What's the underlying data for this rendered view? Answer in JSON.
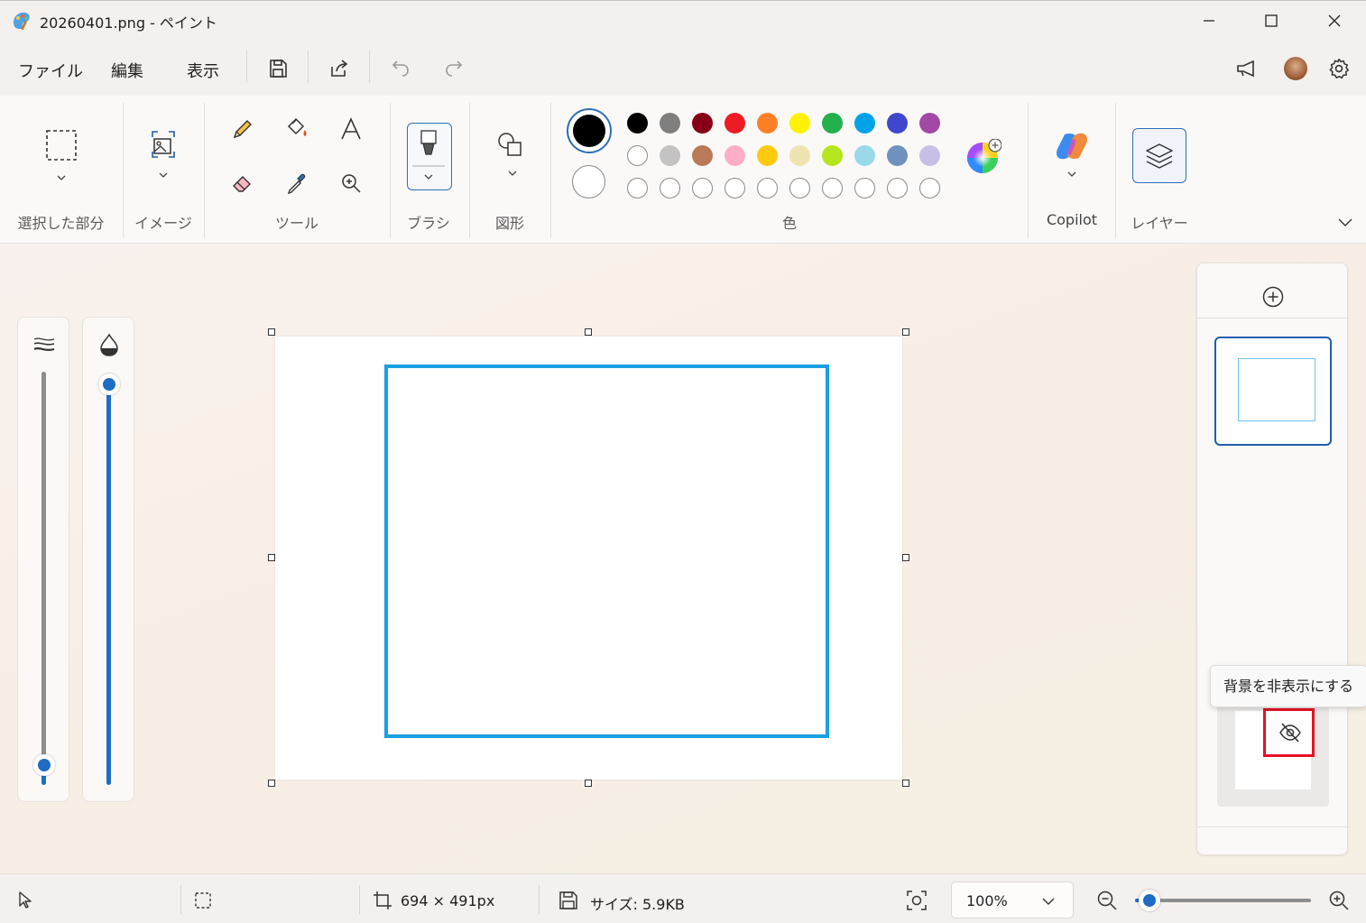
{
  "window": {
    "title": "20260401.png - ペイント",
    "icon": "paint-app-icon",
    "controls": [
      "minimize-icon",
      "maximize-icon",
      "close-icon"
    ]
  },
  "menu": {
    "file": "ファイル",
    "edit": "編集",
    "view": "表示",
    "toolbar_icons": [
      "save-icon",
      "share-icon",
      "undo-icon",
      "redo-icon"
    ],
    "right_icons": [
      "announcement-icon",
      "avatar",
      "settings-icon"
    ]
  },
  "ribbon": {
    "groups": {
      "selection": "選択した部分",
      "image": "イメージ",
      "tools": "ツール",
      "brush": "ブラシ",
      "shapes": "図形",
      "colors": "色",
      "copilot": "Copilot",
      "layers": "レイヤー"
    },
    "tools": [
      "pencil-icon",
      "fill-icon",
      "text-icon",
      "eraser-icon",
      "color-picker-icon",
      "magnifier-icon"
    ],
    "primary_color": "#000000",
    "secondary_color": "#ffffff",
    "palette_row1": [
      "#000000",
      "#7f7f7f",
      "#880015",
      "#ed1c24",
      "#ff7f27",
      "#fff200",
      "#22b14c",
      "#00a2e8",
      "#3f48cc",
      "#a349a4"
    ],
    "palette_row2": [
      "#ffffff",
      "#c3c3c3",
      "#b97a57",
      "#ffaec9",
      "#ffc90e",
      "#efe4b0",
      "#b5e61d",
      "#99d9ea",
      "#7092be",
      "#c8bfe7"
    ],
    "palette_row3_count": 10
  },
  "canvas": {
    "rectangle_color": "#1aa0e0",
    "brush_size_level": 0.0,
    "opacity_level": 1.0
  },
  "layers": {
    "add_icon": "add-layer-icon",
    "tooltip": "背景を非表示にする",
    "hide_icon": "eye-off-icon",
    "highlight_color": "#e81123"
  },
  "status": {
    "dimensions": "694 × 491px",
    "size": "サイズ: 5.9KB",
    "zoom": "100%",
    "zoom_level": 0.08
  }
}
